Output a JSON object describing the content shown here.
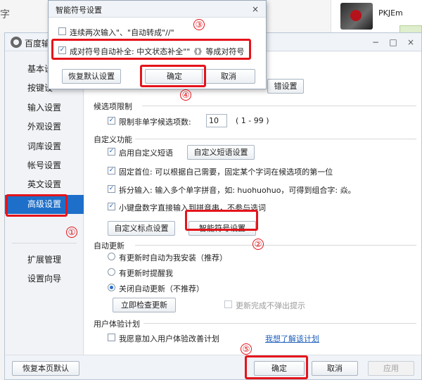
{
  "background": {
    "left_char": "字",
    "username": "PKJEm"
  },
  "window": {
    "title": "百度输",
    "controls": {
      "minimize": "−",
      "maximize": "□",
      "close": "×"
    }
  },
  "sidebar": {
    "items": [
      {
        "label": "基本设"
      },
      {
        "label": "按键设"
      },
      {
        "label": "输入设置"
      },
      {
        "label": "外观设置"
      },
      {
        "label": "词库设置"
      },
      {
        "label": "帐号设置"
      },
      {
        "label": "英文设置"
      },
      {
        "label": "高级设置"
      },
      {
        "label": "扩展管理"
      },
      {
        "label": "设置向导"
      }
    ],
    "active_index": 7
  },
  "content": {
    "partial_button": "错设置",
    "candidates": {
      "title": "候选项限制",
      "limit_label": "限制非单字候选项数:",
      "limit_value": "10",
      "limit_range": "( 1 - 99 )"
    },
    "custom": {
      "title": "自定义功能",
      "enable_phrase": "启用自定义短语",
      "phrase_settings_button": "自定义短语设置",
      "fixed_first": "固定首位: 可以根据自己需要，固定某个字词在候选项的第一位",
      "split_input": "拆分输入: 输入多个单字拼音，如: huohuohuo，可得到组合字: 焱。",
      "keypad_digits": "小键盘数字直接输入到拼音串，不参与选词",
      "punct_button": "自定义标点设置",
      "smart_symbol_button": "智能符号设置"
    },
    "auto_update": {
      "title": "自动更新",
      "options": [
        {
          "label": "有更新时自动为我安装（推荐）",
          "selected": false
        },
        {
          "label": "有更新时提醒我",
          "selected": false
        },
        {
          "label": "关闭自动更新（不推荐）",
          "selected": true
        }
      ],
      "check_now_button": "立即检查更新",
      "no_popup_label": "更新完成不弹出提示"
    },
    "ux_plan": {
      "title": "用户体验计划",
      "join_label": "我愿意加入用户体验改善计划",
      "learn_link": "我想了解该计划"
    }
  },
  "bottom": {
    "restore_button": "恢复本页默认",
    "ok_button": "确定",
    "cancel_button": "取消",
    "apply_button": "应用"
  },
  "popup": {
    "title": "智能符号设置",
    "close": "×",
    "option1": "连续两次输入\"、\"自动转成\"//\"",
    "option2": "成对符号自动补全: 中文状态补全\"\"《》等成对符号",
    "option1_checked": false,
    "option2_checked": true,
    "restore_button": "恢复默认设置",
    "ok_button": "确定",
    "cancel_button": "取消"
  },
  "annotations": [
    "①",
    "②",
    "③",
    "④",
    "⑤"
  ],
  "colors": {
    "highlight": "#e4141b",
    "active_tab": "#1e6fc9",
    "link": "#1f5fbd"
  }
}
